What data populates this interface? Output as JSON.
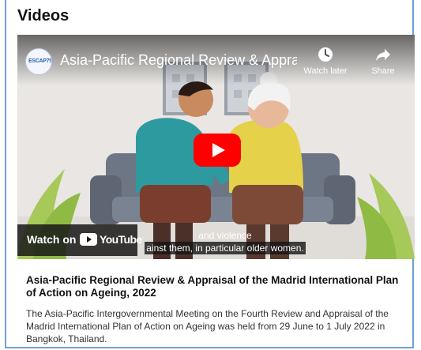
{
  "section": {
    "heading": "Videos"
  },
  "player": {
    "video_title": "Asia-Pacific Regional Review & Appraisа...",
    "channel_logo_text": "ESCAP75",
    "watch_later_label": "Watch later",
    "share_label": "Share",
    "watch_on_label": "Watch on",
    "youtube_label": "YouTube",
    "caption_line1": "and violence",
    "caption_line2": "ainst them, in particular older women.",
    "icons": [
      "clock-icon",
      "share-arrow-icon",
      "play-icon",
      "youtube-logo-icon"
    ]
  },
  "card": {
    "title": "Asia-Pacific Regional Review & Appraisal of the Madrid International Plan of Action on Ageing, 2022",
    "description": "The Asia-Pacific Intergovernmental Meeting on the Fourth Review and Appraisal of the Madrid International Plan of Action on Ageing was held from 29 June to 1 July 2022 in Bangkok, Thailand."
  },
  "colors": {
    "frame_border": "#6fa0d6",
    "youtube_red": "#ff0000",
    "sofa": "#6d7684",
    "man_shirt": "#2d9aa0",
    "woman_shirt": "#e6d24a"
  }
}
